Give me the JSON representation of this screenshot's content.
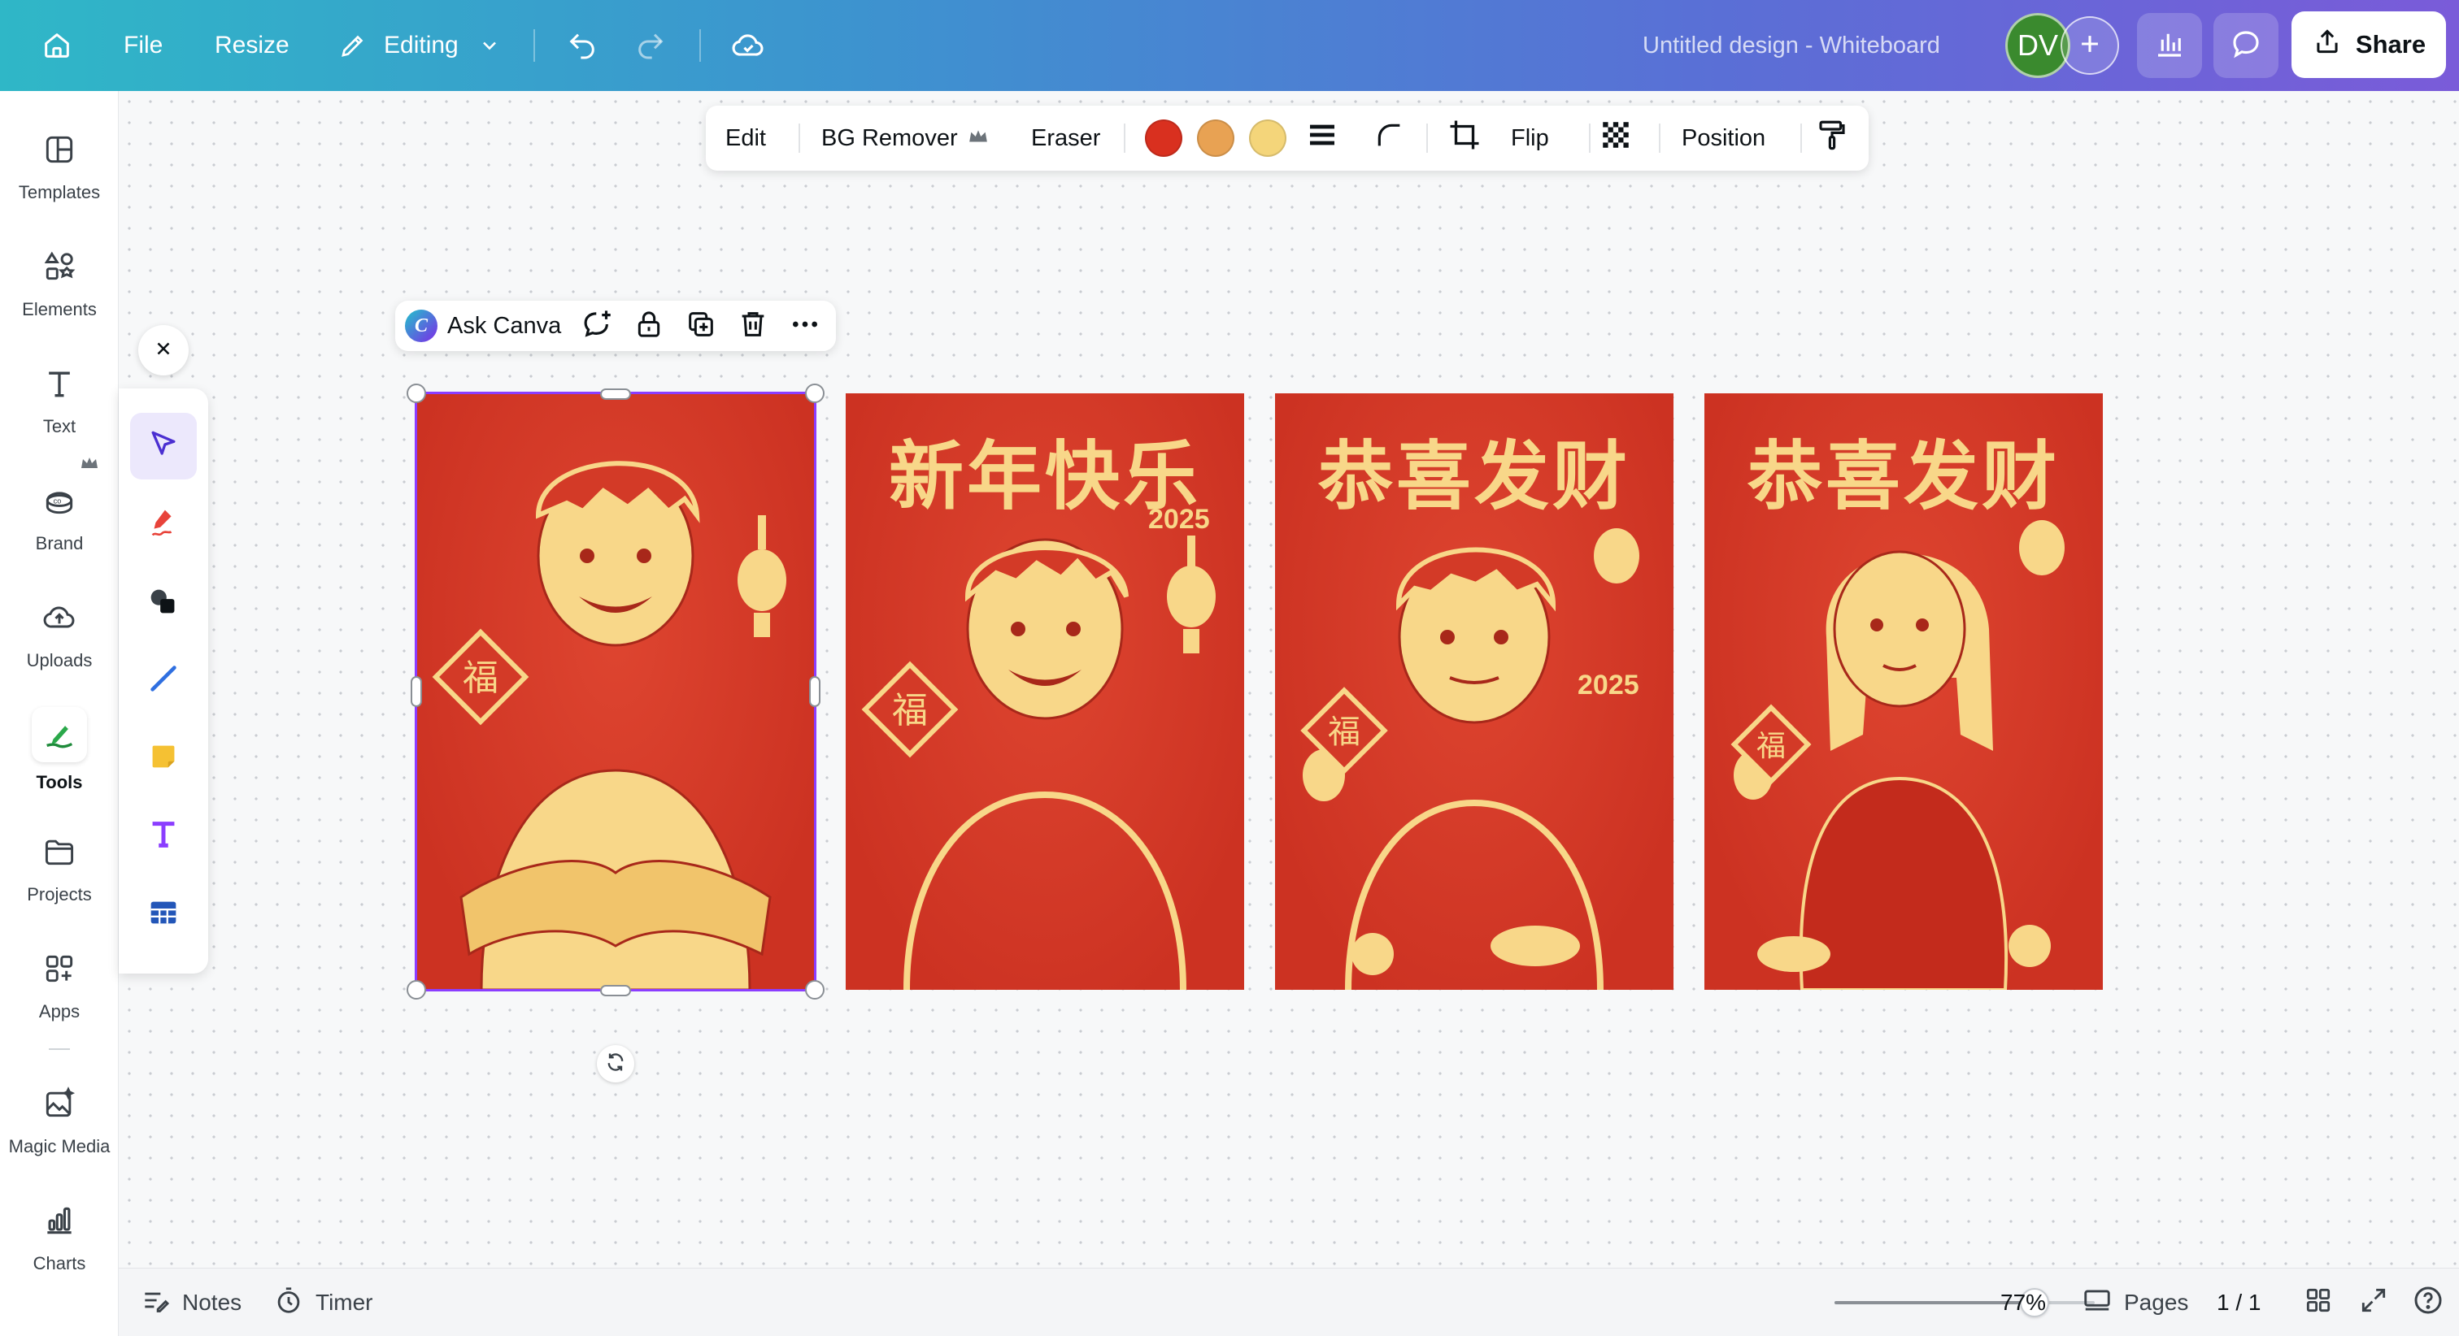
{
  "topbar": {
    "file_label": "File",
    "resize_label": "Resize",
    "editing_label": "Editing",
    "doc_title": "Untitled design - Whiteboard",
    "avatar_initials": "DV",
    "share_label": "Share"
  },
  "sidebar": {
    "items": [
      {
        "label": "Templates",
        "icon": "templates-icon"
      },
      {
        "label": "Elements",
        "icon": "elements-icon"
      },
      {
        "label": "Text",
        "icon": "text-icon"
      },
      {
        "label": "Brand",
        "icon": "brand-icon"
      },
      {
        "label": "Uploads",
        "icon": "uploads-icon"
      },
      {
        "label": "Tools",
        "icon": "tools-icon"
      },
      {
        "label": "Projects",
        "icon": "projects-icon"
      },
      {
        "label": "Apps",
        "icon": "apps-icon"
      },
      {
        "label": "Magic Media",
        "icon": "magic-media-icon"
      },
      {
        "label": "Charts",
        "icon": "charts-icon"
      }
    ]
  },
  "element_toolbar": {
    "edit": "Edit",
    "bg_remover": "BG Remover",
    "eraser": "Eraser",
    "flip": "Flip",
    "position": "Position",
    "colors": [
      "#d9301f",
      "#e8a253",
      "#f4d57a"
    ]
  },
  "ask_bar": {
    "label": "Ask Canva"
  },
  "cards": [
    {
      "title": "",
      "year": ""
    },
    {
      "title": "新年快乐",
      "year": "2025"
    },
    {
      "title": "恭喜发财",
      "year": "2025"
    },
    {
      "title": "恭喜发财",
      "year": ""
    }
  ],
  "bottombar": {
    "notes": "Notes",
    "timer": "Timer",
    "zoom": "77%",
    "zoom_level": 0.77,
    "pages": "Pages",
    "page_count": "1 / 1"
  }
}
